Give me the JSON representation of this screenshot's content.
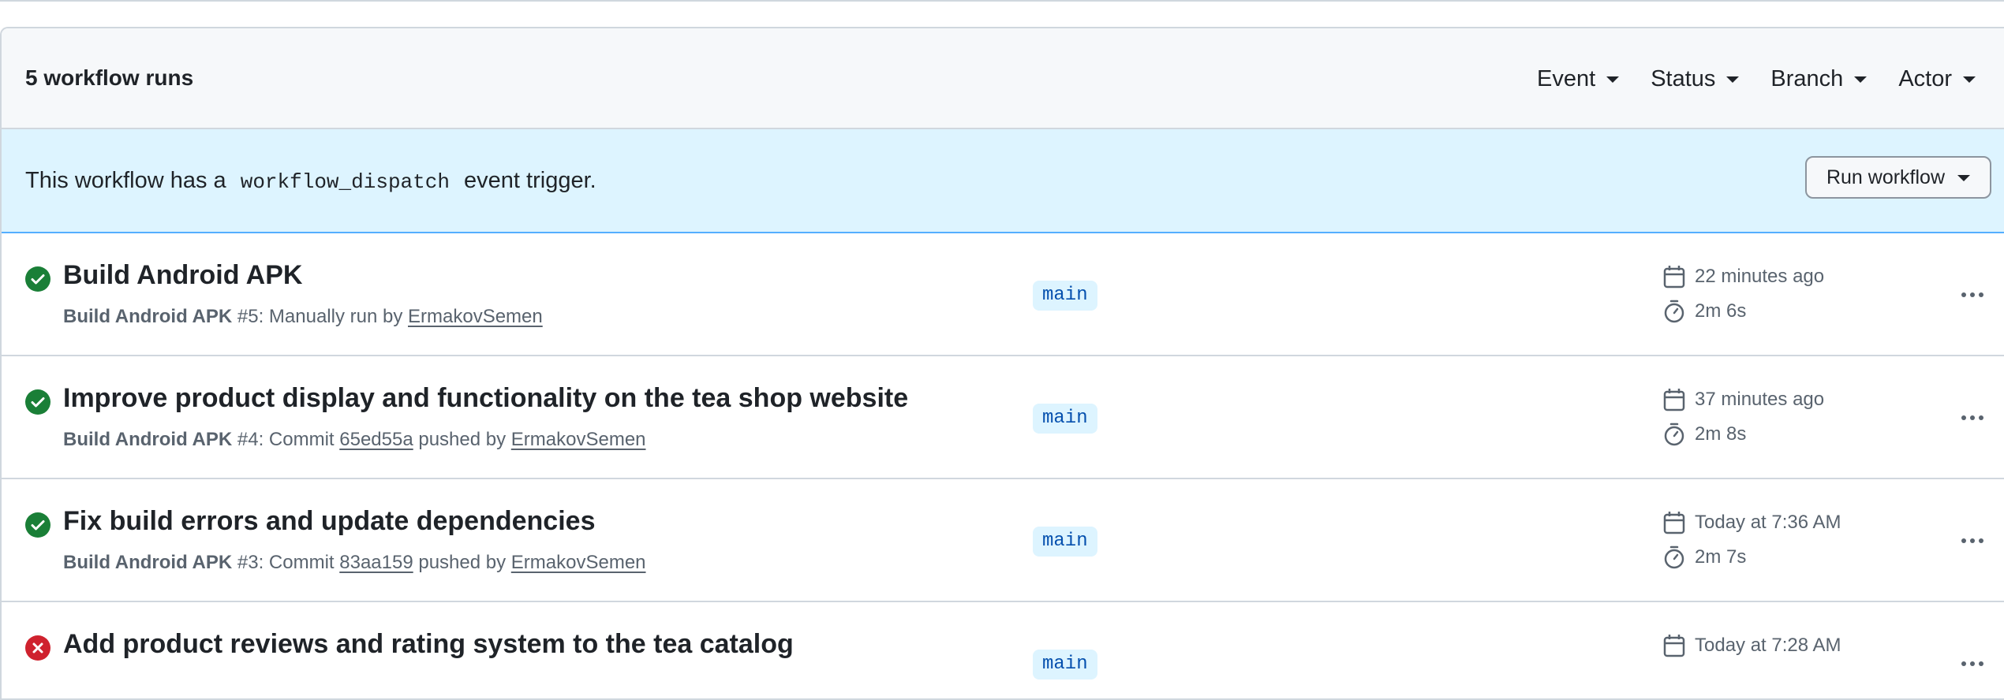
{
  "header": {
    "runs_count": "5 workflow runs",
    "filters": [
      "Event",
      "Status",
      "Branch",
      "Actor"
    ]
  },
  "dispatch": {
    "prefix": "This workflow has a",
    "code": "workflow_dispatch",
    "suffix": "event trigger.",
    "button": "Run workflow"
  },
  "colors": {
    "success": "#1a7f37",
    "failure": "#cf222e",
    "banner": "#ddf4ff",
    "header_bg": "#f6f8fa"
  },
  "runs": [
    {
      "status": "success",
      "title": "Build Android APK",
      "workflow": "Build Android APK",
      "number": "#5",
      "trigger_text": ": Manually run by ",
      "commit": "",
      "actor": "ErmakovSemen",
      "branch": "main",
      "time": "22 minutes ago",
      "duration": "2m 6s"
    },
    {
      "status": "success",
      "title": "Improve product display and functionality on the tea shop website",
      "workflow": "Build Android APK",
      "number": "#4",
      "trigger_text": ": Commit ",
      "commit": "65ed55a",
      "pushed_by": " pushed by ",
      "actor": "ErmakovSemen",
      "branch": "main",
      "time": "37 minutes ago",
      "duration": "2m 8s"
    },
    {
      "status": "success",
      "title": "Fix build errors and update dependencies",
      "workflow": "Build Android APK",
      "number": "#3",
      "trigger_text": ": Commit ",
      "commit": "83aa159",
      "pushed_by": " pushed by ",
      "actor": "ErmakovSemen",
      "branch": "main",
      "time": "Today at 7:36 AM",
      "duration": "2m 7s"
    },
    {
      "status": "failure",
      "title": "Add product reviews and rating system to the tea catalog",
      "branch": "main",
      "time": "Today at 7:28 AM"
    }
  ]
}
